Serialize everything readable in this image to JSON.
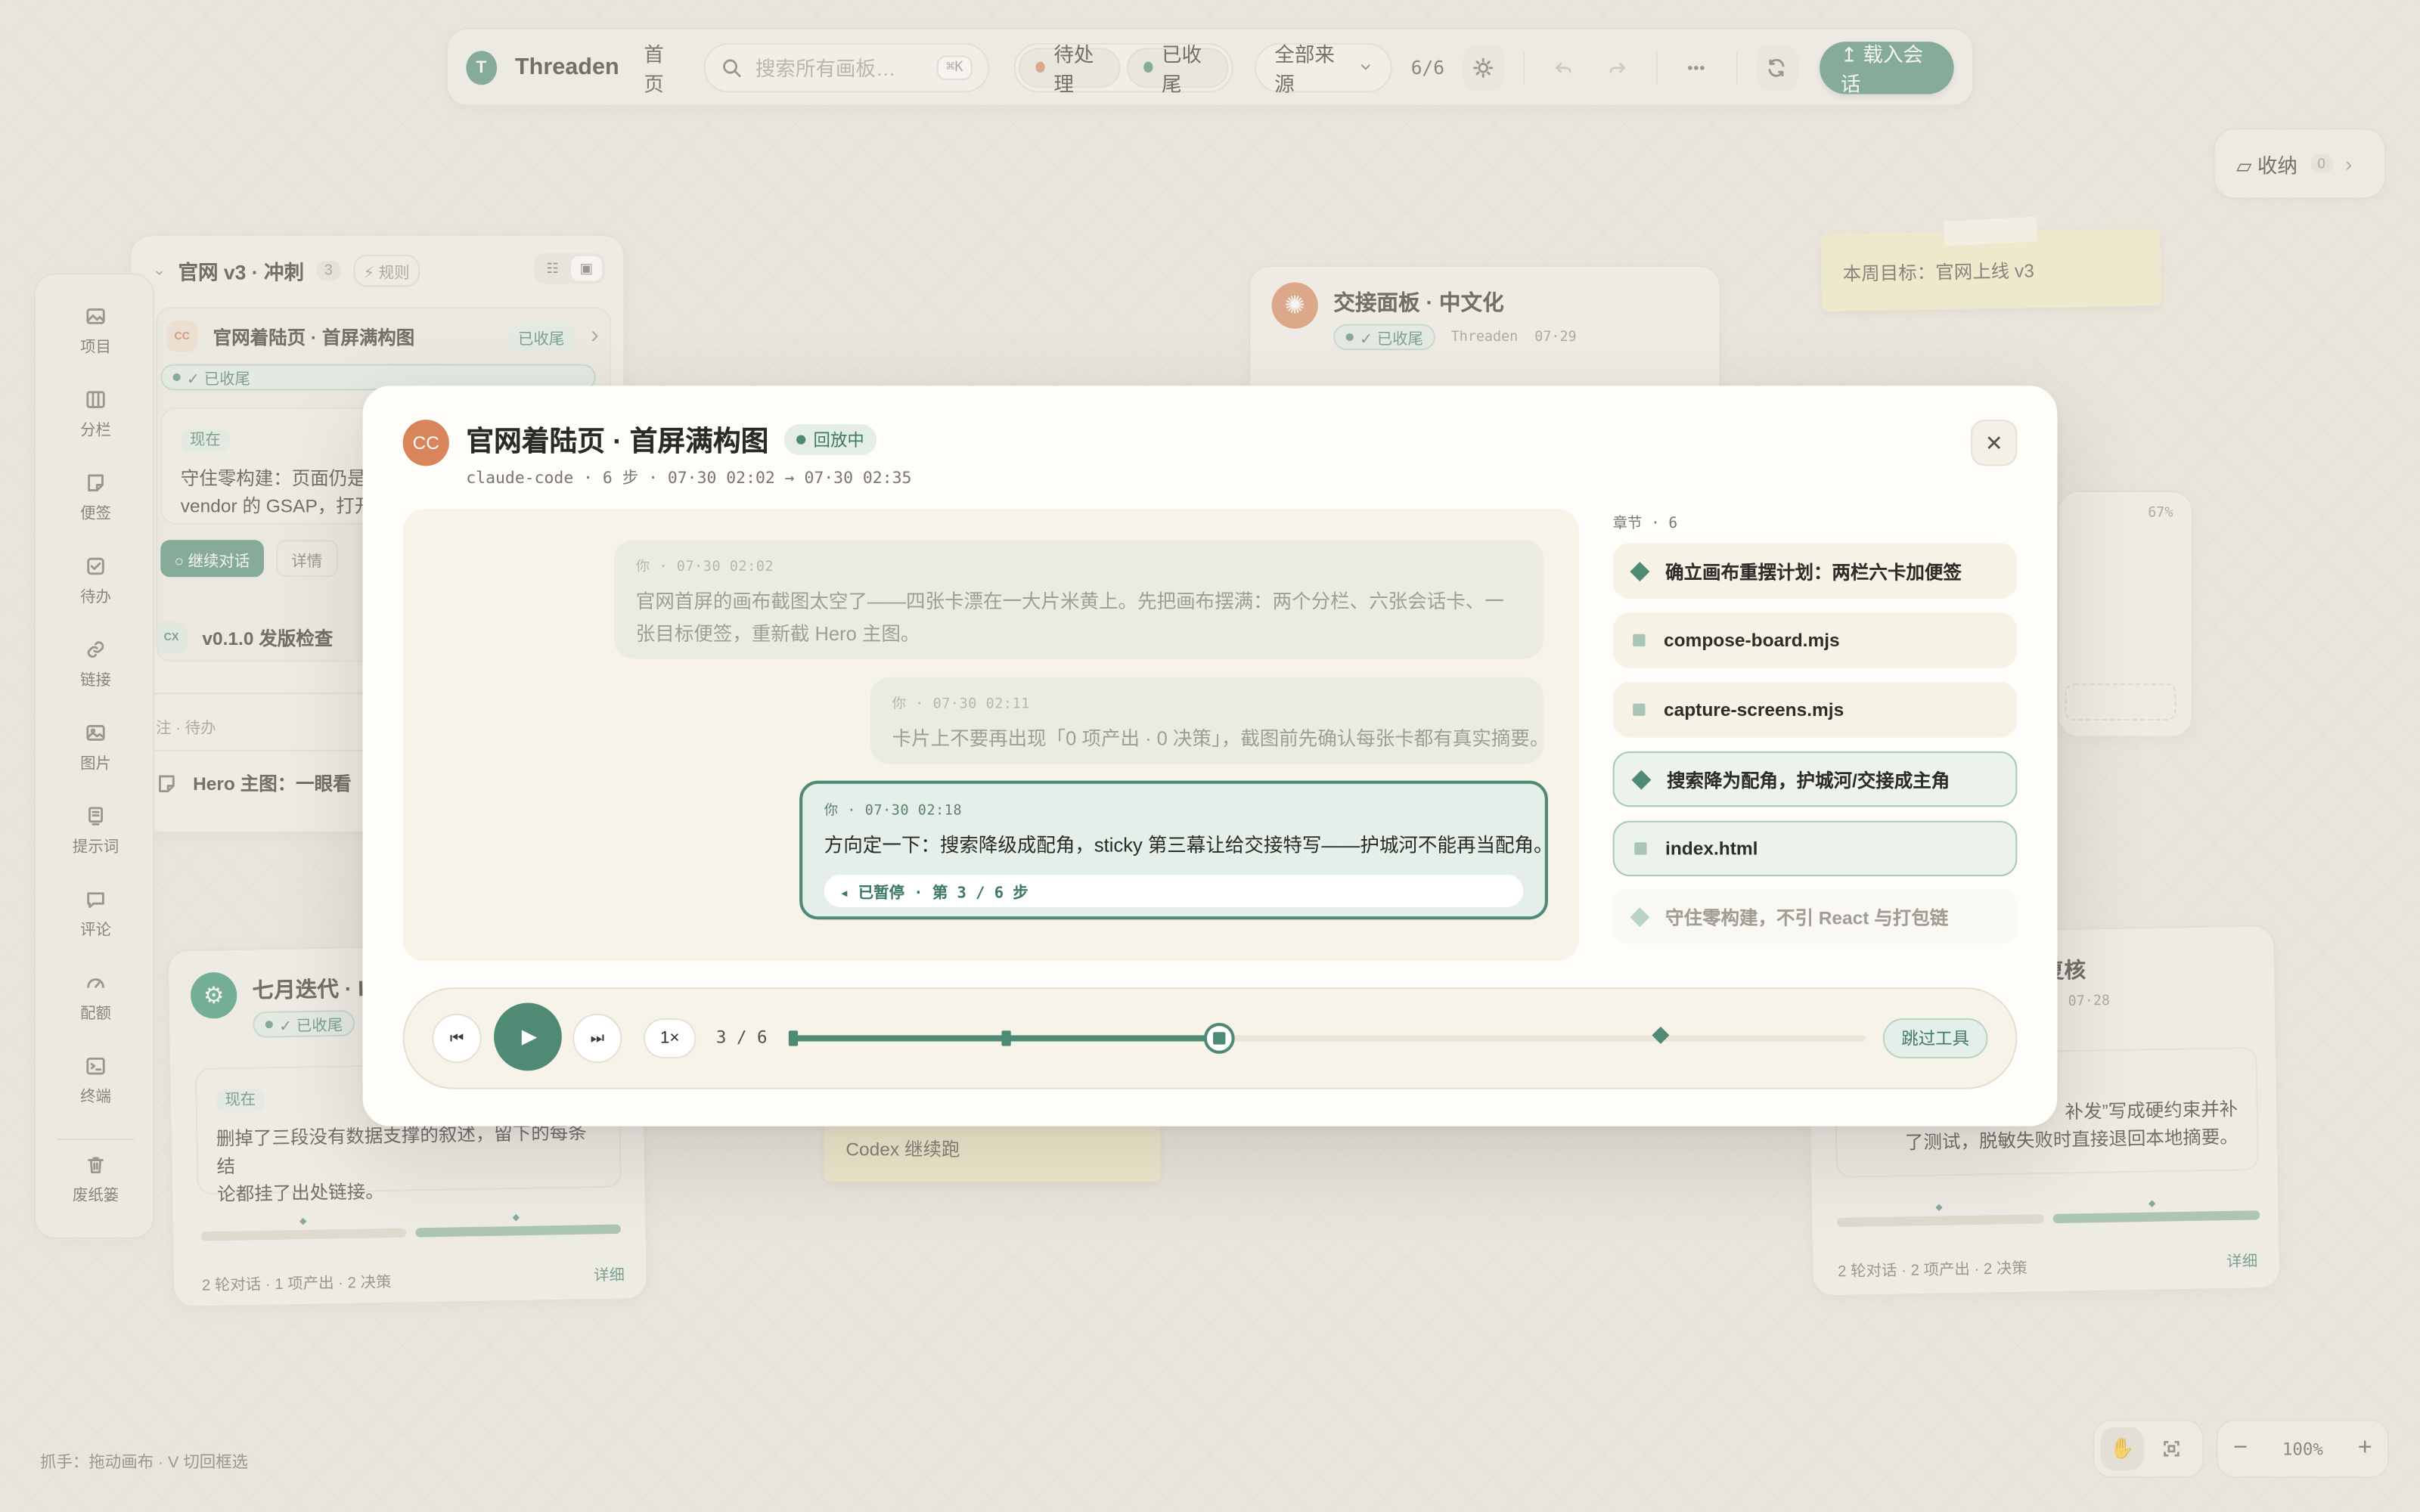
{
  "topbar": {
    "logo_letter": "T",
    "brand": "Threaden",
    "home": "首页",
    "search_placeholder": "搜索所有画板…",
    "search_shortcut": "⌘K",
    "filter_pending": "待处理",
    "filter_archived": "已收尾",
    "source_select": "全部来源",
    "count": "6/6",
    "load_session": "↥ 载入会话"
  },
  "inbox": {
    "label": "▱ 收纳",
    "count": "0"
  },
  "left_toolbar": {
    "items": [
      {
        "label": "项目",
        "icon": "image-icon"
      },
      {
        "label": "分栏",
        "icon": "columns-icon"
      },
      {
        "label": "便签",
        "icon": "note-icon"
      },
      {
        "label": "待办",
        "icon": "checkbox-icon"
      },
      {
        "label": "链接",
        "icon": "link-icon"
      },
      {
        "label": "图片",
        "icon": "image-icon"
      },
      {
        "label": "提示词",
        "icon": "prompt-icon"
      },
      {
        "label": "评论",
        "icon": "comment-icon"
      },
      {
        "label": "配额",
        "icon": "gauge-icon"
      },
      {
        "label": "终端",
        "icon": "terminal-icon"
      }
    ],
    "trash": "废纸篓"
  },
  "column_card": {
    "title": "官网 v3 · 冲刺",
    "count": "3",
    "rules": "⚡ 规则",
    "session_badge": "CC",
    "session_title": "官网着陆页 · 首屏满构图",
    "session_status": "已收尾",
    "status_chip": "✓ 已收尾",
    "now_tag": "现在",
    "now_text": "守住零构建：页面仍是单\nvendor 的 GSAP，打开",
    "continue_btn": "○ 继续对话",
    "detail_btn": "详情",
    "cx_badge": "CX",
    "cx_title": "v0.1.0 发版检查",
    "note_footer": "注 · 待办",
    "hero_title": "Hero 主图：一眼看"
  },
  "handoff_card": {
    "title": "交接面板 · 中文化",
    "status": "✓ 已收尾",
    "meta": "Threaden  07·29"
  },
  "right_card": {
    "percent": "67%"
  },
  "sticky_goal": {
    "text": "本周目标：官网上线 v3"
  },
  "july_card": {
    "title": "七月迭代 · I",
    "status": "✓ 已收尾",
    "now_tag": "现在",
    "text": "删掉了三段没有数据支撑的叙述，留下的每条结\n论都挂了出处链接。",
    "stats": "2 轮对话 · 1 项产出 · 2 决策",
    "detail": "详细"
  },
  "review_card": {
    "title": "复核",
    "meta": "n  07·28",
    "text": "补发”写成硬约束并补\n了测试，脱敏失败时直接退回本地摘要。",
    "stats": "2 轮对话 · 2 项产出 · 2 决策",
    "detail": "详细"
  },
  "codex_sticky": {
    "text": "Codex 继续跑"
  },
  "footer": {
    "hint": "抓手：拖动画布 · V 切回框选",
    "zoom": "100%"
  },
  "modal": {
    "avatar": "CC",
    "title": "官网着陆页 · 首屏满构图",
    "status": "回放中",
    "meta": "claude-code · 6 步 · 07·30 02:02 → 07·30 02:35",
    "messages": [
      {
        "meta": "你 · 07·30 02:02",
        "text": "官网首屏的画布截图太空了——四张卡漂在一大片米黄上。先把画布摆满：两个分栏、六张会话卡、一张目标便签，重新截 Hero 主图。"
      },
      {
        "meta": "你 · 07·30 02:11",
        "text": "卡片上不要再出现「0 项产出 · 0 决策」，截图前先确认每张卡都有真实摘要。"
      },
      {
        "meta": "你 · 07·30 02:18",
        "text": "方向定一下：搜索降级成配角，sticky 第三幕让给交接特写——护城河不能再当配角。",
        "paused": "◂ 已暂停 · 第 3 / 6 步"
      }
    ],
    "chapters_label": "章节 · 6",
    "chapters": [
      {
        "label": "确立画布重摆计划：两栏六卡加便签",
        "kind": "decision"
      },
      {
        "label": "compose-board.mjs",
        "kind": "file"
      },
      {
        "label": "capture-screens.mjs",
        "kind": "file"
      },
      {
        "label": "搜索降为配角，护城河/交接成主角",
        "kind": "decision"
      },
      {
        "label": "index.html",
        "kind": "file"
      },
      {
        "label": "守住零构建，不引 React 与打包链",
        "kind": "decision"
      }
    ],
    "player": {
      "speed": "1×",
      "step": "3 / 6",
      "skip": "跳过工具",
      "progress": 0.4
    }
  }
}
